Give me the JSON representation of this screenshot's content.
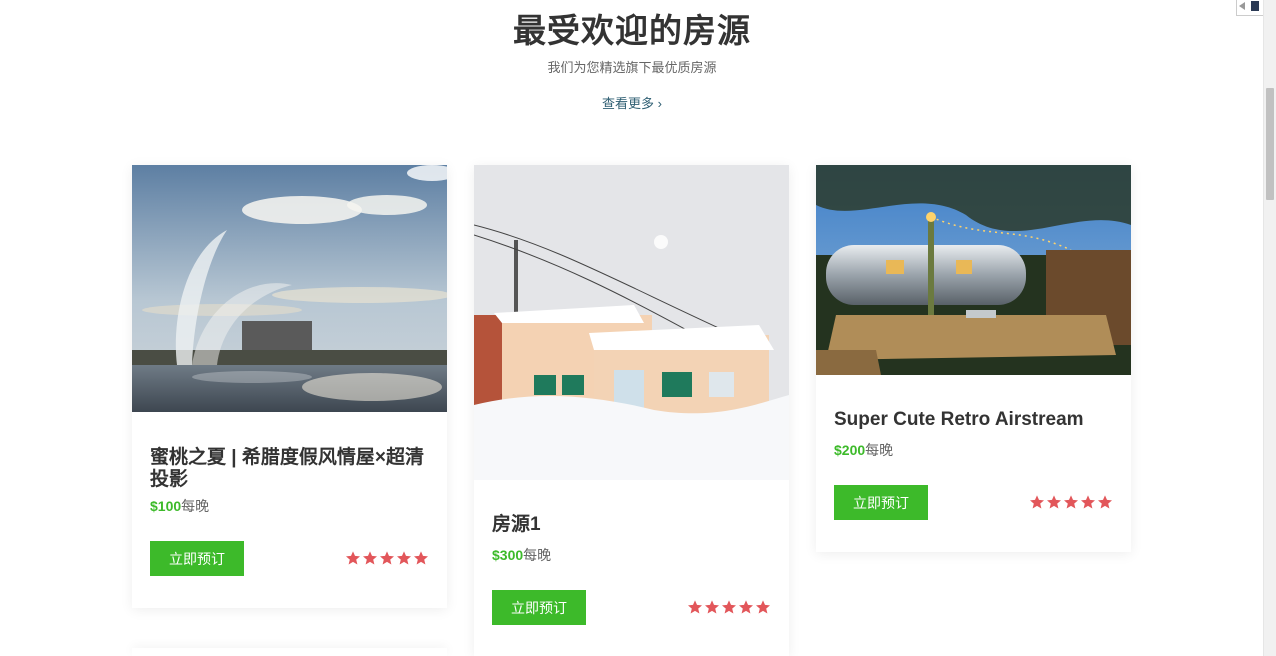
{
  "section": {
    "title": "最受欢迎的房源",
    "subtitle": "我们为您精选旗下最优质房源",
    "more_label": "查看更多 ›"
  },
  "listings": [
    {
      "title": "蜜桃之夏 | 希腊度假风情屋×超清投影",
      "price": "$100",
      "per_night": "每晚",
      "book_label": "立即预订",
      "rating": 5
    },
    {
      "title": "房源1",
      "price": "$300",
      "per_night": "每晚",
      "book_label": "立即预订",
      "rating": 5
    },
    {
      "title": "Super Cute Retro Airstream",
      "price": "$200",
      "per_night": "每晚",
      "book_label": "立即预订",
      "rating": 5
    }
  ],
  "colors": {
    "accent": "#3dba2a",
    "star": "#e2565a",
    "title": "#333333",
    "link": "#2f5f73"
  }
}
